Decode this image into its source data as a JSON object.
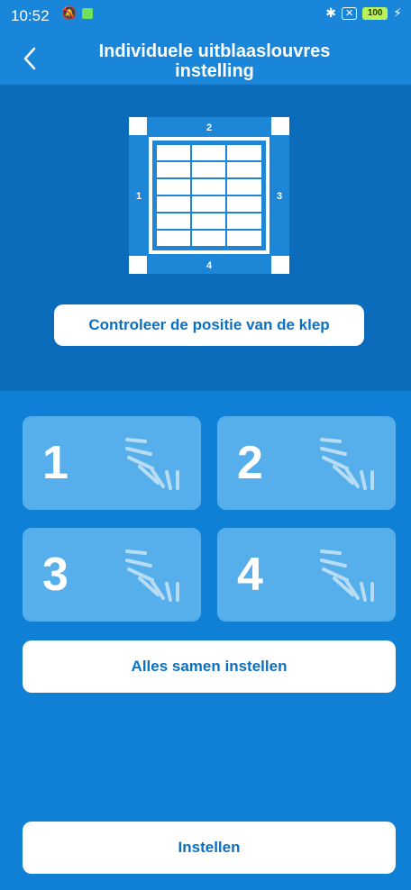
{
  "status_bar": {
    "time": "10:52",
    "battery": "100"
  },
  "header": {
    "title_line1": "Individuele uitblaaslouvres",
    "title_line2": "instelling"
  },
  "diagram": {
    "labels": [
      "1",
      "2",
      "3",
      "4"
    ]
  },
  "buttons": {
    "check_position": "Controleer de positie van de klep",
    "set_all_together": "Alles samen instellen",
    "apply": "Instellen"
  },
  "louvres": [
    {
      "number": "1"
    },
    {
      "number": "2"
    },
    {
      "number": "3"
    },
    {
      "number": "4"
    }
  ],
  "colors": {
    "header_blue": "#1a86da",
    "panel_dark_blue": "#0b6cbb",
    "panel_blue": "#0f80d6",
    "tile_blue": "#56aeeb",
    "button_text": "#0b70c2"
  }
}
